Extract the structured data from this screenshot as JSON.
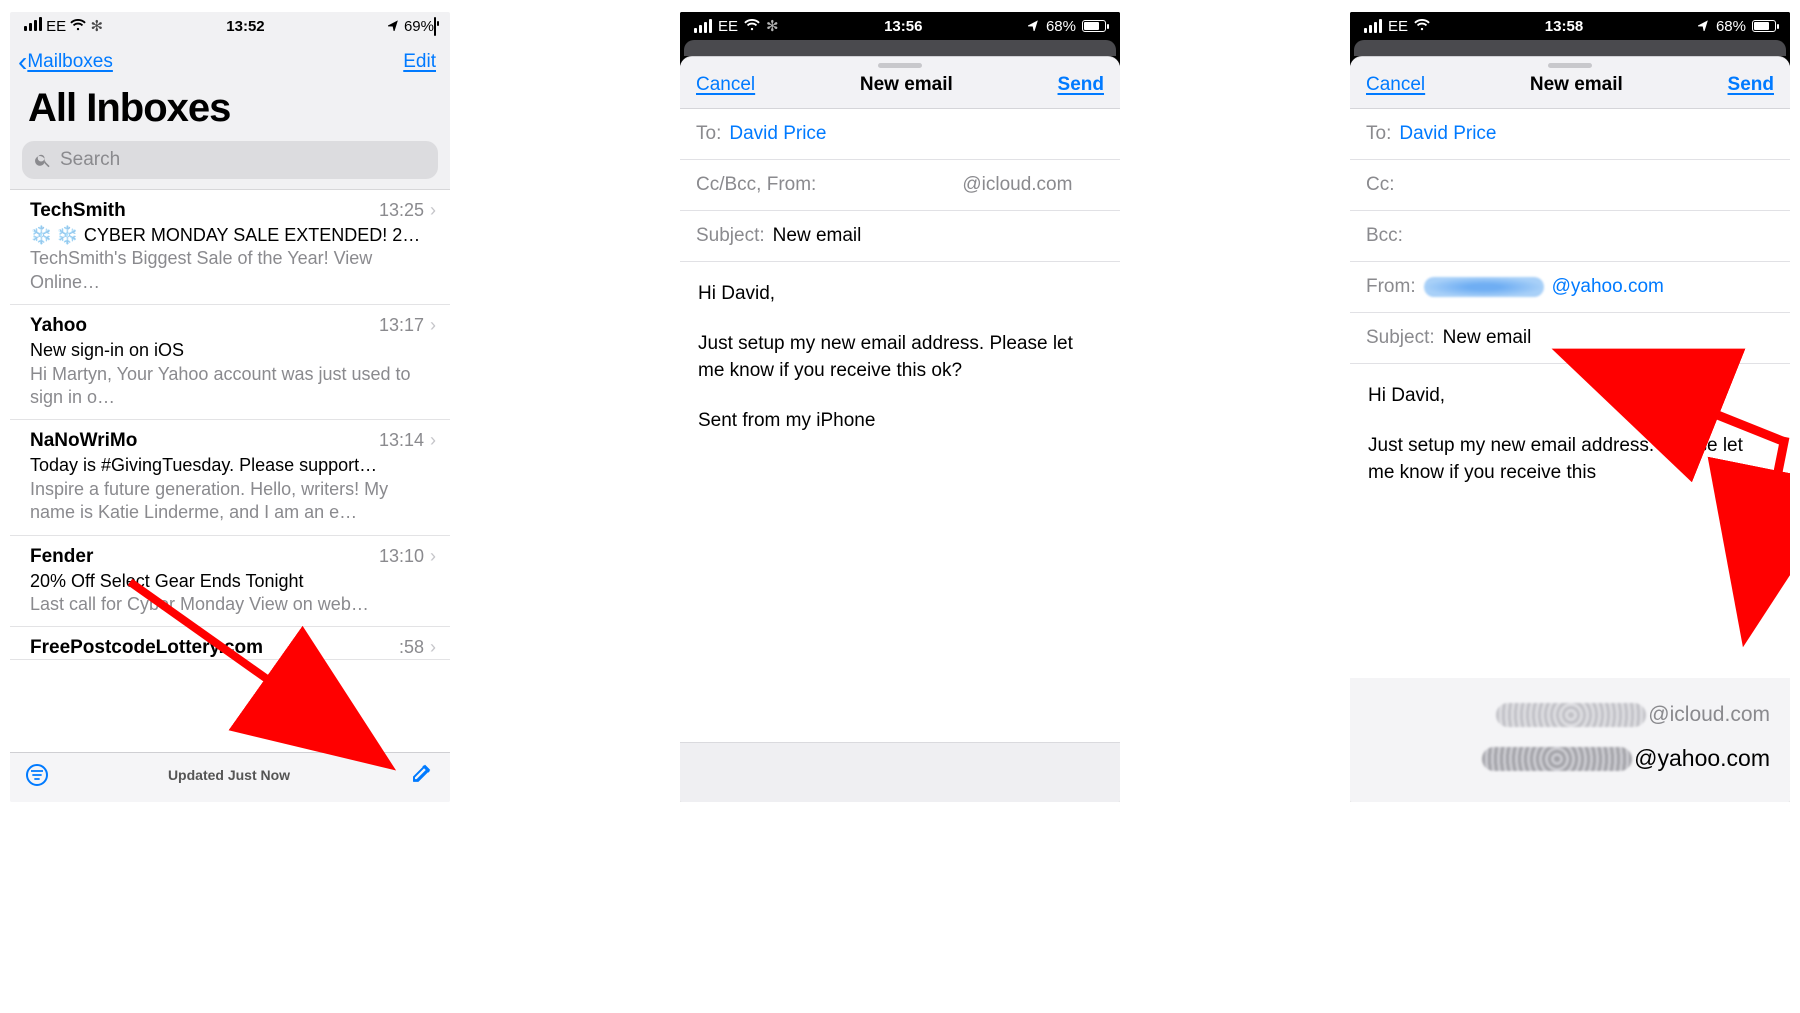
{
  "screen1": {
    "status": {
      "carrier": "EE",
      "time": "13:52",
      "battery": "69%"
    },
    "back_label": "Mailboxes",
    "edit_label": "Edit",
    "title": "All Inboxes",
    "search_placeholder": "Search",
    "emails": [
      {
        "sender": "TechSmith",
        "time": "13:25",
        "subject": "❄️ CYBER MONDAY SALE EXTENDED! 2…",
        "preview": "TechSmith's Biggest Sale of the Year! View Online…"
      },
      {
        "sender": "Yahoo",
        "time": "13:17",
        "subject": "New sign-in on iOS",
        "preview": "Hi Martyn, Your Yahoo account                 was just used to sign in o…"
      },
      {
        "sender": "NaNoWriMo",
        "time": "13:14",
        "subject": "Today is #GivingTuesday. Please support…",
        "preview": "Inspire a future generation. Hello, writers! My name is Katie Linderme, and I am an e…"
      },
      {
        "sender": "Fender",
        "time": "13:10",
        "subject": "20% Off Select Gear Ends Tonight",
        "preview": "Last call for Cyber Monday View on web…"
      },
      {
        "sender": "FreePostcodeLottery.com",
        "time": ":58",
        "subject": "",
        "preview": ""
      }
    ],
    "footer_status": "Updated Just Now"
  },
  "screen2": {
    "status": {
      "carrier": "EE",
      "time": "13:56",
      "battery": "68%"
    },
    "cancel_label": "Cancel",
    "title": "New email",
    "send_label": "Send",
    "to_label": "To:",
    "to_value": "David Price",
    "ccbcc_label": "Cc/Bcc, From:",
    "from_domain": "@icloud.com",
    "subject_label": "Subject:",
    "subject_value": "New email",
    "body_lines": [
      "Hi David,",
      "Just setup my new email address. Please let me know if you receive this ok?",
      "Sent from my iPhone"
    ]
  },
  "screen3": {
    "status": {
      "carrier": "EE",
      "time": "13:58",
      "battery": "68%"
    },
    "cancel_label": "Cancel",
    "title": "New email",
    "send_label": "Send",
    "to_label": "To:",
    "to_value": "David Price",
    "cc_label": "Cc:",
    "bcc_label": "Bcc:",
    "from_label": "From:",
    "from_domain": "@yahoo.com",
    "subject_label": "Subject:",
    "subject_value": "New email",
    "body_lines": [
      "Hi David,",
      "Just setup my new email address. Please let me know if you receive this"
    ],
    "option_icloud": "@icloud.com",
    "option_yahoo": "@yahoo.com"
  }
}
